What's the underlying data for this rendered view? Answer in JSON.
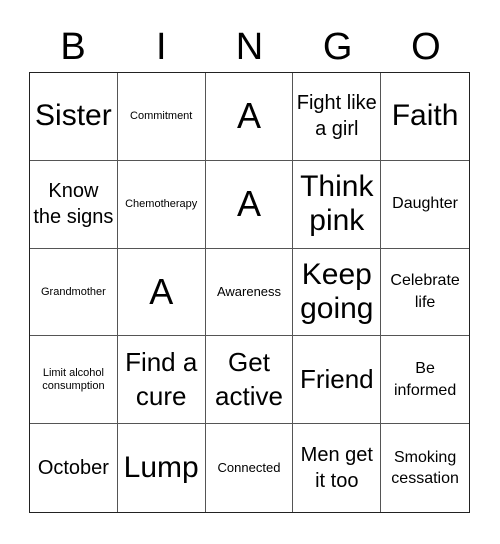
{
  "header": [
    "B",
    "I",
    "N",
    "G",
    "O"
  ],
  "cells": [
    {
      "text": "Sister",
      "size": "s-xxl"
    },
    {
      "text": "Commitment",
      "size": "s-xs"
    },
    {
      "text": "A",
      "size": "s-free"
    },
    {
      "text": "Fight like a girl",
      "size": "s-lg"
    },
    {
      "text": "Faith",
      "size": "s-xxl"
    },
    {
      "text": "Know the signs",
      "size": "s-lg"
    },
    {
      "text": "Chemotherapy",
      "size": "s-xs"
    },
    {
      "text": "A",
      "size": "s-free"
    },
    {
      "text": "Think pink",
      "size": "s-xxl"
    },
    {
      "text": "Daughter",
      "size": "s-md"
    },
    {
      "text": "Grandmother",
      "size": "s-xs"
    },
    {
      "text": "A",
      "size": "s-free"
    },
    {
      "text": "Awareness",
      "size": "s-sm"
    },
    {
      "text": "Keep going",
      "size": "s-xxl"
    },
    {
      "text": "Celebrate life",
      "size": "s-md"
    },
    {
      "text": "Limit alcohol consumption",
      "size": "s-xs"
    },
    {
      "text": "Find a cure",
      "size": "s-xl"
    },
    {
      "text": "Get active",
      "size": "s-xl"
    },
    {
      "text": "Friend",
      "size": "s-xl"
    },
    {
      "text": "Be informed",
      "size": "s-md"
    },
    {
      "text": "October",
      "size": "s-lg"
    },
    {
      "text": "Lump",
      "size": "s-xxl"
    },
    {
      "text": "Connected",
      "size": "s-sm"
    },
    {
      "text": "Men get it too",
      "size": "s-lg"
    },
    {
      "text": "Smoking cessation",
      "size": "s-md"
    }
  ]
}
